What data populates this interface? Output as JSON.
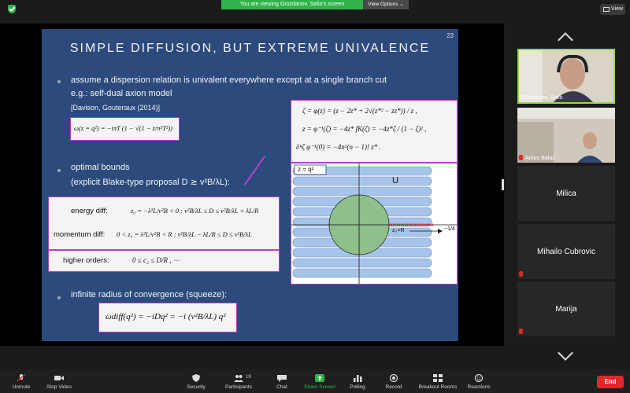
{
  "topbar": {
    "banner": "You are viewing Grozdanov, Sašo's screen",
    "view_options": "View Options ⌄",
    "view_button": "View"
  },
  "slide": {
    "number": "23",
    "title": "SIMPLE DIFFUSION, BUT EXTREME UNIVALENCE",
    "bullet1_line1": "assume a dispersion relation is univalent everywhere except at a single branch cut",
    "bullet1_line2": "e.g.: self-dual axion model",
    "bullet1_ref": "[Davison, Gouteraux (2014)]",
    "bullet1_formula": "ω(z = q²) = −iπT (1 − √(1 − z/π²T²))",
    "bullet2_line1": "optimal bounds",
    "bullet2_line2": "(explicit Blake-type proposal  D ≳ v²B/λL):",
    "bounds": {
      "energy_label": "energy diff:",
      "energy_formula": "z₀ = −λ²L/v²B < 0 :   v²B/λL ≤ D ≤ v²B/λL + λL/R",
      "momentum_label": "momentum diff:",
      "momentum_formula": "0 < z₀ = λ²L/v²B < R :   v²B/λL − λL/R ≤ D ≤ v²B/λL",
      "higher_label": "higher orders:",
      "higher_formula": "0 ≤ c₂ ≤ D/R ,  ⋯"
    },
    "bullet3_line1": "infinite radius of convergence (squeeze):",
    "bullet3_formula": "ωdiff(q²) = −iDq² = −i (v²B/λL) q²",
    "map_box": {
      "line1": "ζ = φ(z) = (z − 2z* + 2√(z*² − zz*)) / z ,",
      "line2": "z = φ⁻¹(ζ) = −4z* fK(ζ) = −4z*ζ / (1 − ζ)² ,",
      "line3": "∂ⁿζ φ⁻¹(0) = −4n²(n − 1)! z* ."
    },
    "figure": {
      "z_label": "z = q²",
      "u_label": "U",
      "r_label": "z₀=R",
      "arrow_label": "−1/4"
    }
  },
  "participants": [
    {
      "name": "Grozdanov, Sašo",
      "type": "video"
    },
    {
      "name": "Antun Balaz",
      "type": "video"
    },
    {
      "name": "Milica",
      "type": "name"
    },
    {
      "name": "Mihailo Cubrovic",
      "type": "name"
    },
    {
      "name": "Marija",
      "type": "name"
    }
  ],
  "toolbar": {
    "unmute": "Unmute",
    "stop_video": "Stop Video",
    "security": "Security",
    "participants": "Participants",
    "participants_count": "19",
    "chat": "Chat",
    "share_screen": "Share Screen",
    "polling": "Polling",
    "record": "Record",
    "breakout": "Breakout Rooms",
    "reactions": "Reactions",
    "end": "End"
  },
  "colors": {
    "slide_bg": "#2c4a7c",
    "accent_magenta": "#b83bd1",
    "zoom_green": "#2fb34a",
    "end_red": "#e02828"
  }
}
